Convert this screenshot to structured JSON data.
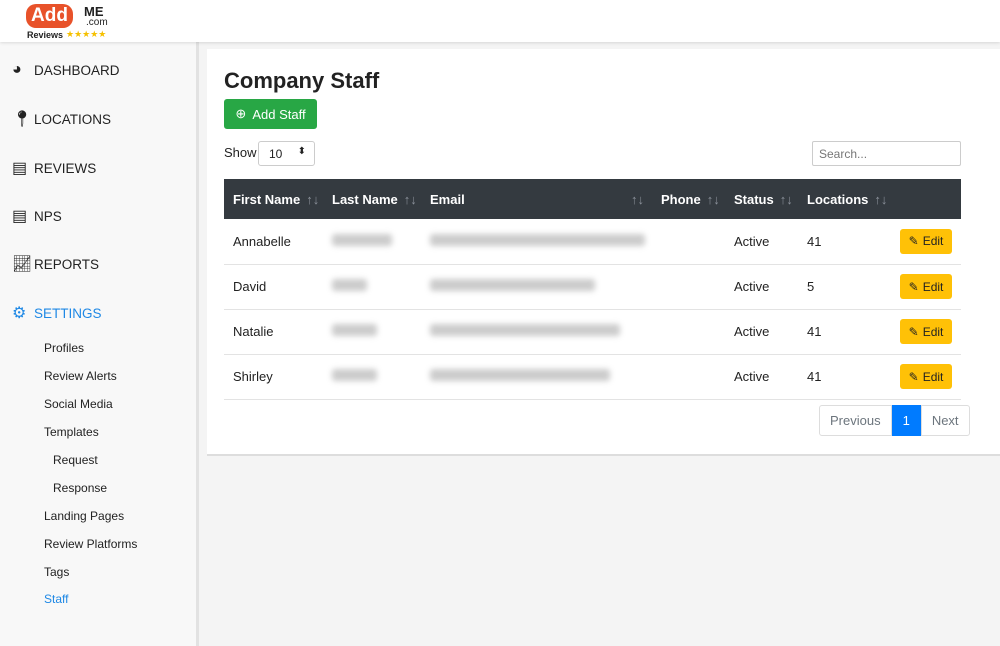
{
  "logo": {
    "add": "Add",
    "me": "ME",
    "com": ".com",
    "reviews": "Reviews",
    "stars": "★★★★★"
  },
  "nav": [
    {
      "label": "DASHBOARD",
      "icon": "pie-chart-icon"
    },
    {
      "label": "LOCATIONS",
      "icon": "map-marker-icon"
    },
    {
      "label": "REVIEWS",
      "icon": "document-icon"
    },
    {
      "label": "NPS",
      "icon": "document-icon"
    },
    {
      "label": "REPORTS",
      "icon": "line-chart-icon"
    },
    {
      "label": "SETTINGS",
      "icon": "gear-icon",
      "active": true
    }
  ],
  "settings_sub": [
    "Profiles",
    "Review Alerts",
    "Social Media",
    "Templates",
    "Request",
    "Response",
    "Landing Pages",
    "Review Platforms",
    "Tags",
    "Staff"
  ],
  "page": {
    "title": "Company Staff",
    "add_label": "Add Staff",
    "show_label": "Show",
    "page_size": "10",
    "search_placeholder": "Search..."
  },
  "table": {
    "headers": [
      "First Name",
      "Last Name",
      "Email",
      "Phone",
      "Status",
      "Locations"
    ],
    "rows": [
      {
        "first": "Annabelle",
        "status": "Active",
        "locations": "41"
      },
      {
        "first": "David",
        "status": "Active",
        "locations": "5"
      },
      {
        "first": "Natalie",
        "status": "Active",
        "locations": "41"
      },
      {
        "first": "Shirley",
        "status": "Active",
        "locations": "41"
      }
    ],
    "edit_label": "Edit"
  },
  "pagination": {
    "previous": "Previous",
    "current": "1",
    "next": "Next"
  },
  "colors": {
    "accent": "#1e88e5",
    "add": "#28a745",
    "edit": "#ffc107",
    "header": "#343a40"
  }
}
